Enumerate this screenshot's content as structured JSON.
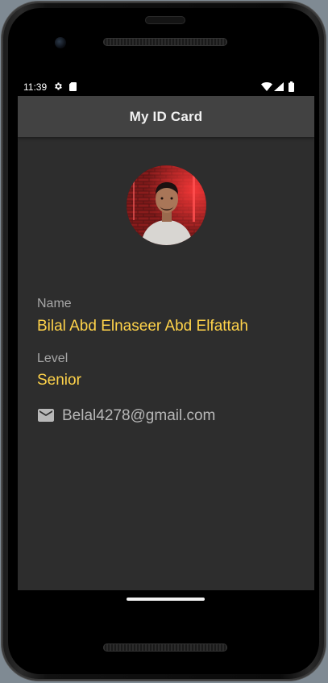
{
  "status_bar": {
    "time": "11:39",
    "icons": [
      "gear-icon",
      "sd-card-icon",
      "wifi-icon",
      "signal-icon",
      "battery-icon"
    ]
  },
  "app_bar": {
    "title": "My ID Card"
  },
  "profile": {
    "avatar": "profile-photo"
  },
  "fields": {
    "name_label": "Name",
    "name_value": "Bilal Abd Elnaseer Abd Elfattah",
    "level_label": "Level",
    "level_value": "Senior",
    "email_icon": "mail-icon",
    "email_value": "Belal4278@gmail.com"
  },
  "colors": {
    "background": "#2d2d2d",
    "app_bar": "#424242",
    "accent": "#ffd34a",
    "label": "#a7a7a7"
  }
}
